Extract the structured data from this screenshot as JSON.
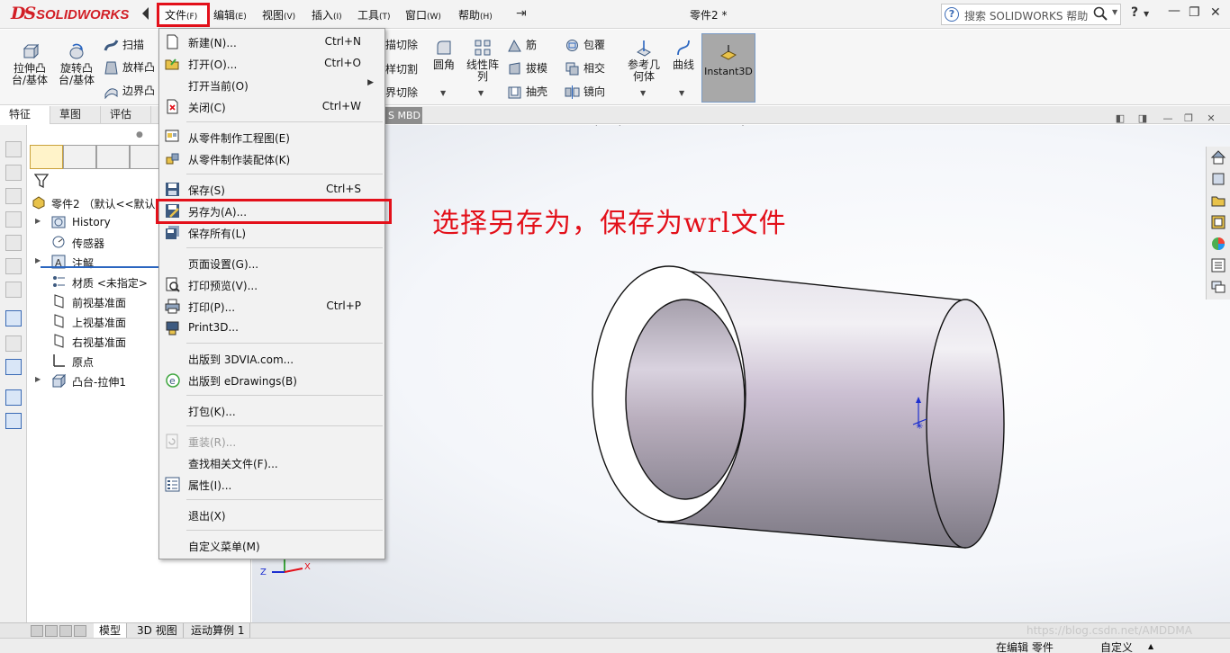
{
  "app": {
    "logo_text": "SOLIDWORKS",
    "document_title": "零件2 *",
    "accent_color": "#d21f26",
    "highlight_color": "#e3101a"
  },
  "menubar": {
    "items": [
      {
        "label": "文件",
        "hotkey": "(F)"
      },
      {
        "label": "编辑",
        "hotkey": "(E)"
      },
      {
        "label": "视图",
        "hotkey": "(V)"
      },
      {
        "label": "插入",
        "hotkey": "(I)"
      },
      {
        "label": "工具",
        "hotkey": "(T)"
      },
      {
        "label": "窗口",
        "hotkey": "(W)"
      },
      {
        "label": "帮助",
        "hotkey": "(H)"
      }
    ]
  },
  "search": {
    "placeholder": "搜索 SOLIDWORKS 帮助",
    "help_label": "?"
  },
  "ribbon": {
    "extrude_boss": "拉伸凸\n台/基体",
    "revolve_boss": "旋转凸\n台/基体",
    "sweep": "扫描",
    "loft": "放样凸",
    "boundary": "边界凸",
    "cut_extrude": "描切除",
    "cut_loft": "样切割",
    "cut_boundary": "界切除",
    "fillet": "圆角",
    "linear_pattern": "线性阵\n列",
    "rib": "筋",
    "draft": "拔模",
    "shell": "抽壳",
    "wrap": "包覆",
    "intersect": "相交",
    "mirror": "镜向",
    "reference_geometry": "参考几\n何体",
    "curves": "曲线",
    "instant3d": "Instant3D"
  },
  "command_tabs": [
    "特征",
    "草图",
    "评估"
  ],
  "mbd_tab": "S MBD",
  "feature_tree": {
    "root": "零件2 （默认<<默认>",
    "items": [
      {
        "label": "History",
        "expandable": true
      },
      {
        "label": "传感器",
        "expandable": false
      },
      {
        "label": "注解",
        "expandable": true
      },
      {
        "label": "材质 <未指定>",
        "expandable": false
      },
      {
        "label": "前视基准面",
        "expandable": false
      },
      {
        "label": "上视基准面",
        "expandable": false
      },
      {
        "label": "右视基准面",
        "expandable": false
      },
      {
        "label": "原点",
        "expandable": false
      },
      {
        "label": "凸台-拉伸1",
        "expandable": true
      }
    ]
  },
  "file_menu": {
    "items": [
      {
        "label": "新建(N)...",
        "shortcut": "Ctrl+N",
        "icon": "new-document-icon"
      },
      {
        "label": "打开(O)...",
        "shortcut": "Ctrl+O",
        "icon": "open-folder-icon"
      },
      {
        "label": "打开当前(O)",
        "shortcut": "",
        "icon": "",
        "submenu": "▶"
      },
      {
        "label": "关闭(C)",
        "shortcut": "Ctrl+W",
        "icon": "close-document-icon"
      },
      {
        "label": "从零件制作工程图(E)",
        "shortcut": "",
        "icon": "make-drawing-icon"
      },
      {
        "label": "从零件制作装配体(K)",
        "shortcut": "",
        "icon": "make-assembly-icon"
      },
      {
        "label": "保存(S)",
        "shortcut": "Ctrl+S",
        "icon": "save-icon"
      },
      {
        "label": "另存为(A)...",
        "shortcut": "",
        "icon": "save-as-icon"
      },
      {
        "label": "保存所有(L)",
        "shortcut": "",
        "icon": "save-all-icon"
      },
      {
        "label": "页面设置(G)...",
        "shortcut": "",
        "icon": ""
      },
      {
        "label": "打印预览(V)...",
        "shortcut": "",
        "icon": "print-preview-icon"
      },
      {
        "label": "打印(P)...",
        "shortcut": "Ctrl+P",
        "icon": "print-icon"
      },
      {
        "label": "Print3D...",
        "shortcut": "",
        "icon": "print3d-icon"
      },
      {
        "label": "出版到 3DVIA.com...",
        "shortcut": "",
        "icon": ""
      },
      {
        "label": "出版到 eDrawings(B)",
        "shortcut": "",
        "icon": "edrawings-icon"
      },
      {
        "label": "打包(K)...",
        "shortcut": "",
        "icon": ""
      },
      {
        "label": "重装(R)...",
        "shortcut": "",
        "icon": "reload-icon",
        "disabled": true
      },
      {
        "label": "查找相关文件(F)...",
        "shortcut": "",
        "icon": ""
      },
      {
        "label": "属性(I)...",
        "shortcut": "",
        "icon": "properties-icon"
      },
      {
        "label": "退出(X)",
        "shortcut": "",
        "icon": ""
      },
      {
        "label": "自定义菜单(M)",
        "shortcut": "",
        "icon": ""
      }
    ]
  },
  "annotation": "选择另存为，保存为wrl文件",
  "triad_labels": {
    "z": "Z",
    "x": "X"
  },
  "bottom_tabs": [
    "模型",
    "3D 视图",
    "运动算例 1"
  ],
  "status": {
    "editing": "在编辑 零件",
    "custom": "自定义"
  },
  "watermark": "https://blog.csdn.net/AMDDMA"
}
